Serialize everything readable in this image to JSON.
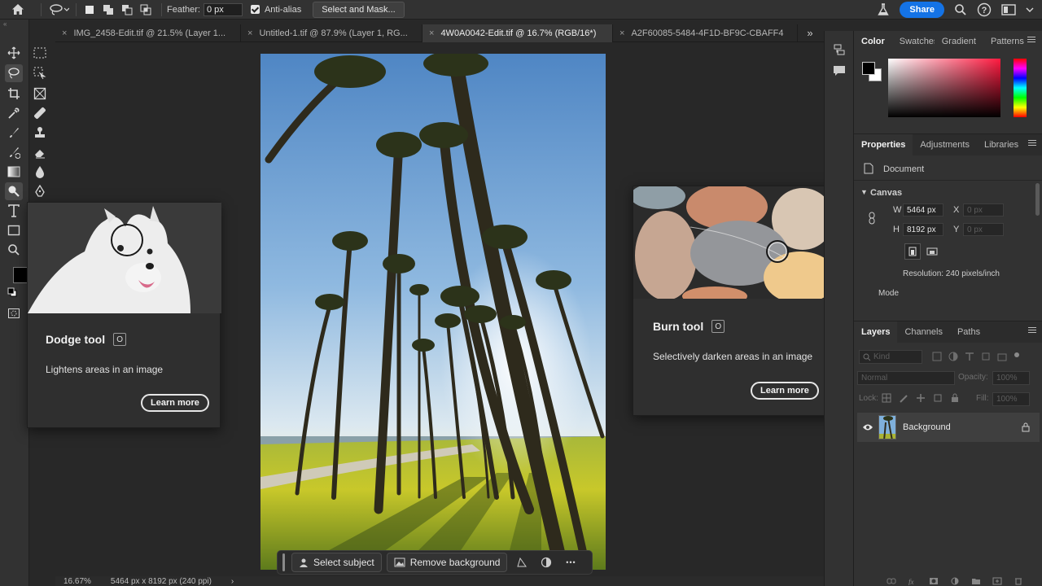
{
  "option_bar": {
    "feather_label": "Feather:",
    "feather_value": "0 px",
    "anti_alias_label": "Anti-alias",
    "anti_alias_checked": true,
    "select_and_mask": "Select and Mask...",
    "share": "Share"
  },
  "tabs": [
    {
      "label": "IMG_2458-Edit.tif @ 21.5% (Layer 1...",
      "active": false
    },
    {
      "label": "Untitled-1.tif @ 87.9% (Layer 1, RG...",
      "active": false
    },
    {
      "label": "4W0A0042-Edit.tif @ 16.7% (RGB/16*)",
      "active": true
    },
    {
      "label": "A2F60085-5484-4F1D-BF9C-CBAFF4",
      "active": false
    }
  ],
  "tab_close": "×",
  "tabs_overflow": "»",
  "taskbar": {
    "select_subject": "Select subject",
    "remove_background": "Remove background",
    "more": "•••"
  },
  "statusbar": {
    "zoom": "16.67%",
    "doc_size": "5464 px x 8192 px (240 ppi)",
    "arrow": "›"
  },
  "dodge_tip": {
    "title": "Dodge tool",
    "shortcut": "O",
    "description": "Lightens areas in an image",
    "learn_more": "Learn more"
  },
  "burn_tip": {
    "title": "Burn tool",
    "shortcut": "O",
    "description": "Selectively darken areas in an image",
    "learn_more": "Learn more"
  },
  "color_panel": {
    "tabs": [
      "Color",
      "Swatches",
      "Gradient",
      "Patterns"
    ],
    "foreground": "#000000",
    "background": "#ffffff"
  },
  "properties_panel": {
    "tabs": [
      "Properties",
      "Adjustments",
      "Libraries"
    ],
    "doc_label": "Document",
    "canvas_label": "Canvas",
    "w_label": "W",
    "w_value": "5464 px",
    "h_label": "H",
    "h_value": "8192 px",
    "x_label": "X",
    "x_value": "0 px",
    "y_label": "Y",
    "y_value": "0 px",
    "resolution": "Resolution: 240 pixels/inch",
    "mode_label": "Mode"
  },
  "layers_panel": {
    "tabs": [
      "Layers",
      "Channels",
      "Paths"
    ],
    "kind_placeholder": "Kind",
    "blend_mode": "Normal",
    "opacity_label": "Opacity:",
    "opacity_value": "100%",
    "lock_label": "Lock:",
    "fill_label": "Fill:",
    "fill_value": "100%",
    "layer_name": "Background"
  },
  "colors": {
    "accent": "#1473e6",
    "ui_bg": "#323232",
    "canvas_bg": "#282828"
  }
}
